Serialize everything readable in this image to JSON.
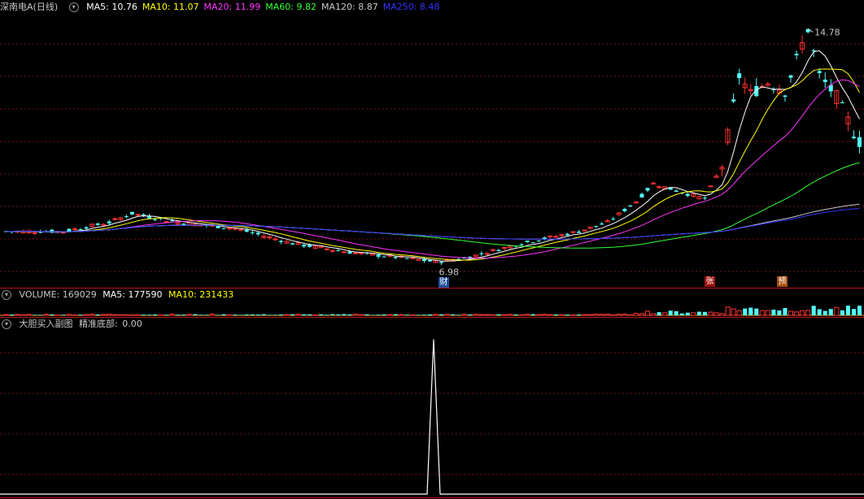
{
  "price_header": {
    "title": "深南电A(日线)",
    "ma": [
      {
        "label": "MA5:",
        "value": "10.76",
        "color": "#ffffff"
      },
      {
        "label": "MA10:",
        "value": "11.07",
        "color": "#ffff00"
      },
      {
        "label": "MA20:",
        "value": "11.99",
        "color": "#ff33ff"
      },
      {
        "label": "MA60:",
        "value": "9.82",
        "color": "#33ff33"
      },
      {
        "label": "MA120:",
        "value": "8.87",
        "color": "#c8c8c8"
      },
      {
        "label": "MA250:",
        "value": "8.48",
        "color": "#3333ff"
      }
    ]
  },
  "volume_header": {
    "title": "VOLUME: 169029",
    "ma5": "MA5: 177590",
    "ma10": "MA10: 231433"
  },
  "indicator_header": {
    "title": "大胆买入副图",
    "label": "精准底部:",
    "value": "0.00"
  },
  "annotations": {
    "high": "14.78",
    "low": "6.98",
    "badge_cai": "财",
    "badge_zhang": "张",
    "badge_yu": "预"
  },
  "colors": {
    "up": "#ff3232",
    "down": "#54ffff",
    "grid": "#7a1010",
    "separator": "#b01818"
  },
  "chart_data": {
    "type": "candlestick",
    "price_ylim": [
      6.5,
      15.2
    ],
    "high_marker": 14.78,
    "low_marker": 6.98,
    "indicator_peak": 1.0,
    "indicator_ylim": [
      0,
      1.05
    ]
  }
}
